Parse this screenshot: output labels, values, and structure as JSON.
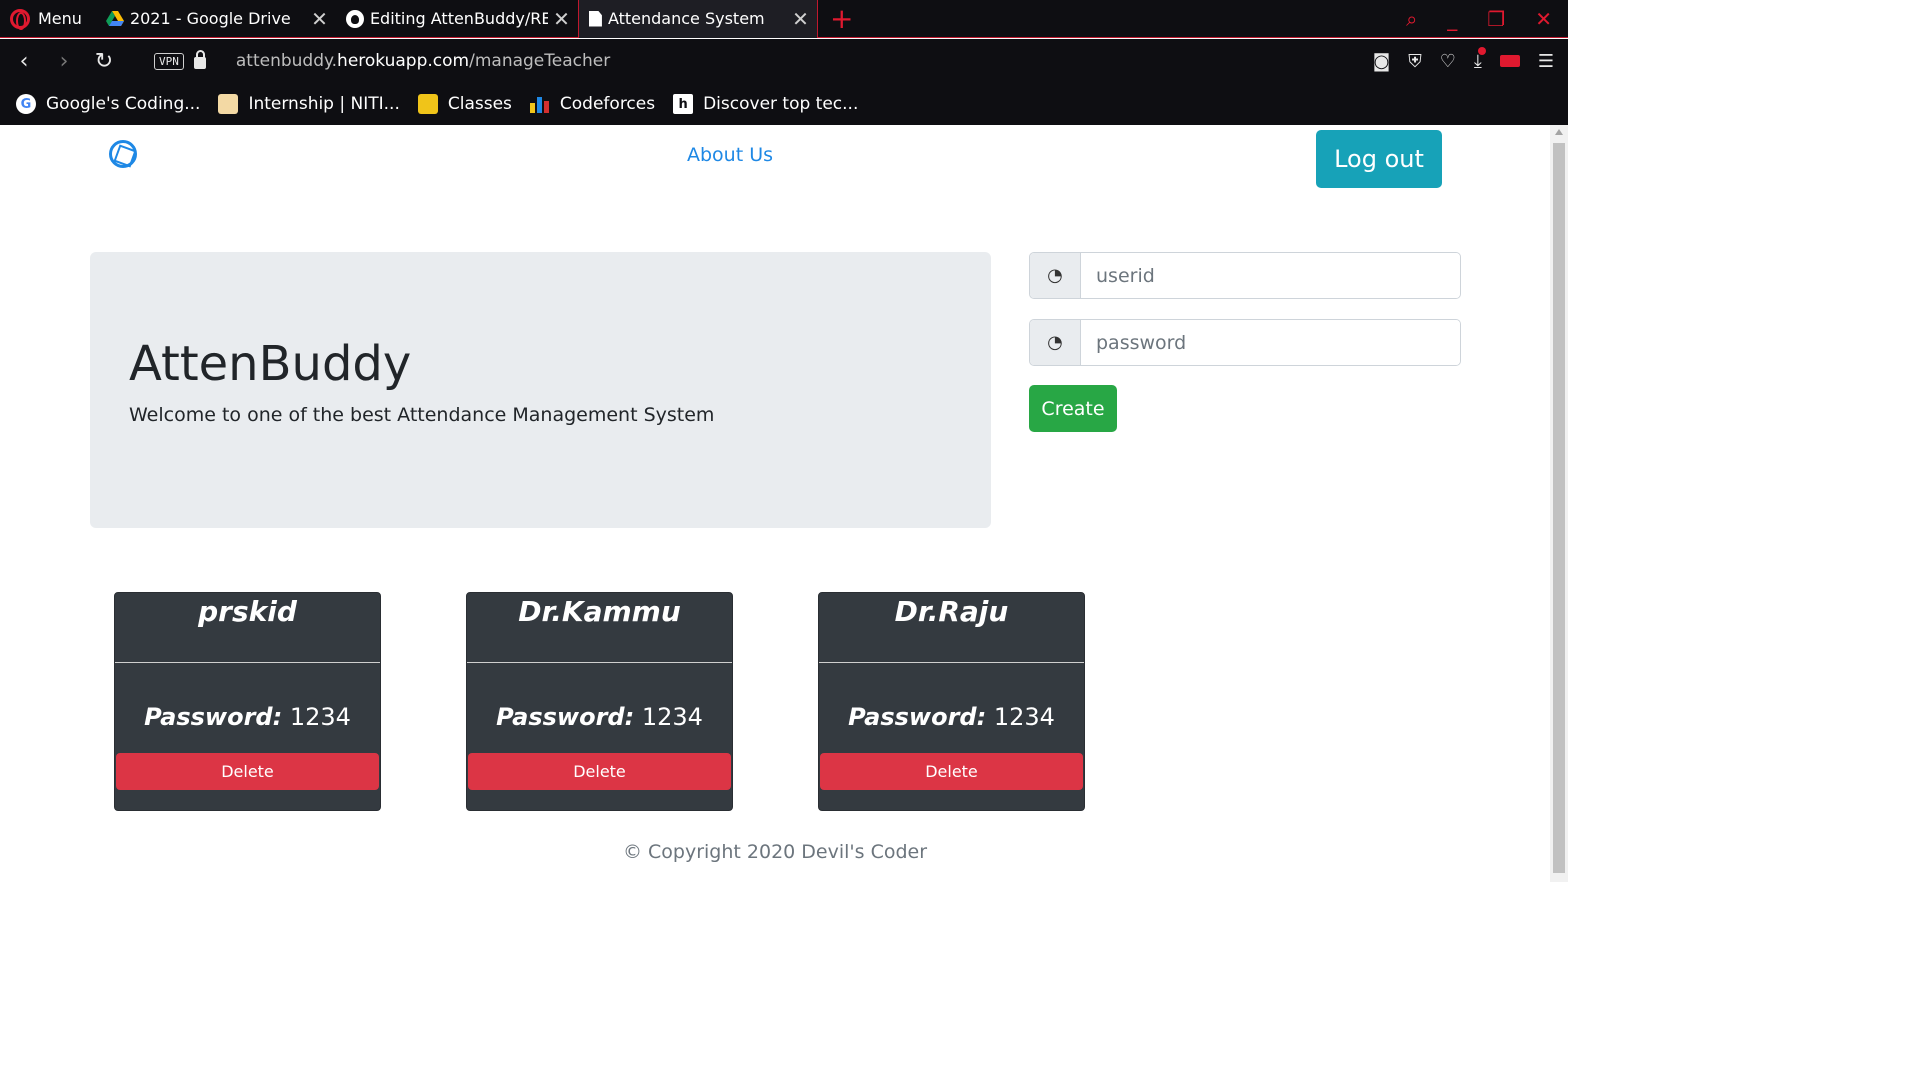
{
  "browser": {
    "menu_label": "Menu",
    "tabs": [
      {
        "title": "2021 - Google Drive",
        "icon": "google-drive-icon"
      },
      {
        "title": "Editing AttenBuddy/RE",
        "icon": "github-icon"
      },
      {
        "title": "Attendance System",
        "icon": "document-icon",
        "active": true
      }
    ],
    "vpn_label": "VPN",
    "url_prefix": "attenbuddy.",
    "url_domain": "herokuapp.com",
    "url_path": "/manageTeacher",
    "bookmarks": [
      {
        "label": "Google's Coding...",
        "icon": "google-icon",
        "glyph": "G"
      },
      {
        "label": "Internship | NITI...",
        "icon": "niti-icon",
        "glyph": ""
      },
      {
        "label": "Classes",
        "icon": "classroom-icon",
        "glyph": ""
      },
      {
        "label": "Codeforces",
        "icon": "codeforces-icon",
        "glyph": ""
      },
      {
        "label": "Discover top tec...",
        "icon": "hackernoon-icon",
        "glyph": "h"
      }
    ],
    "accent_color": "#e0192f"
  },
  "nav": {
    "about_label": "About Us",
    "logout_label": "Log out"
  },
  "hero": {
    "title": "AttenBuddy",
    "subtitle": "Welcome to one of the best Attendance Management System"
  },
  "form": {
    "userid_placeholder": "userid",
    "password_placeholder": "password",
    "create_label": "Create",
    "prepend_icon": "swirl-icon"
  },
  "teachers": [
    {
      "name": "prskid",
      "password_label": "Password:",
      "password": "1234",
      "delete_label": "Delete"
    },
    {
      "name": "Dr.Kammu",
      "password_label": "Password:",
      "password": "1234",
      "delete_label": "Delete"
    },
    {
      "name": "Dr.Raju",
      "password_label": "Password:",
      "password": "1234",
      "delete_label": "Delete"
    }
  ],
  "footer": {
    "text": "© Copyright 2020 Devil's Coder"
  }
}
